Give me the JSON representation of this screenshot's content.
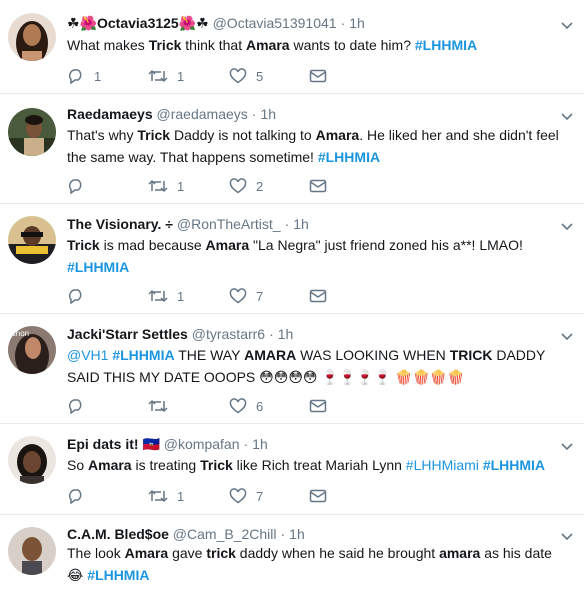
{
  "tweets": [
    {
      "name_prefix": "☘🌺",
      "name": "Octavia3125",
      "name_suffix": "🌺☘",
      "handle": "@Octavia51391041",
      "time": "1h",
      "text": [
        {
          "t": "What makes "
        },
        {
          "t": "Trick",
          "s": "b"
        },
        {
          "t": " think that "
        },
        {
          "t": "Amara",
          "s": "b"
        },
        {
          "t": " wants to date him? "
        },
        {
          "t": "#LHHMIA",
          "s": "tag"
        }
      ],
      "replies": "1",
      "retweets": "1",
      "likes": "5"
    },
    {
      "name": "Raedamaeys",
      "handle": "@raedamaeys",
      "time": "1h",
      "text": [
        {
          "t": "That's why "
        },
        {
          "t": "Trick",
          "s": "b"
        },
        {
          "t": " Daddy is not talking to "
        },
        {
          "t": "Amara",
          "s": "b"
        },
        {
          "t": ". He liked her and she didn't feel the same way. That happens sometime! "
        },
        {
          "t": "#LHHMIA",
          "s": "tag"
        }
      ],
      "replies": "",
      "retweets": "1",
      "likes": "2"
    },
    {
      "name": "The Visionary. ÷",
      "handle": "@RonTheArtist_",
      "time": "1h",
      "text": [
        {
          "t": "Trick",
          "s": "b"
        },
        {
          "t": " is mad because "
        },
        {
          "t": "Amara",
          "s": "b"
        },
        {
          "t": " \"La Negra\" just friend zoned his a**! LMAO! "
        },
        {
          "t": "#LHHMIA",
          "s": "tag"
        }
      ],
      "replies": "",
      "retweets": "1",
      "likes": "7"
    },
    {
      "name": "Jacki'Starr Settles",
      "handle": "@tyrastarr6",
      "time": "1h",
      "text": [
        {
          "t": "@VH1",
          "s": "tagl"
        },
        {
          "t": " "
        },
        {
          "t": "#LHHMIA",
          "s": "tag"
        },
        {
          "t": " THE WAY "
        },
        {
          "t": "AMARA",
          "s": "b"
        },
        {
          "t": " WAS LOOKING WHEN "
        },
        {
          "t": "TRICK",
          "s": "b"
        },
        {
          "t": " DADDY SAID THIS MY DATE OOOPS 😳😳😳😳 🍷🍷🍷🍷 🍿🍿🍿🍿"
        }
      ],
      "replies": "",
      "retweets": "",
      "likes": "6"
    },
    {
      "name": "Epi dats it!",
      "name_suffix": " 🇭🇹",
      "handle": "@kompafan",
      "time": "1h",
      "text": [
        {
          "t": "So "
        },
        {
          "t": "Amara",
          "s": "b"
        },
        {
          "t": " is treating "
        },
        {
          "t": "Trick",
          "s": "b"
        },
        {
          "t": " like Rich treat Mariah Lynn "
        },
        {
          "t": "#LHHMiami",
          "s": "tagl"
        },
        {
          "t": " "
        },
        {
          "t": "#LHHMIA",
          "s": "tag"
        }
      ],
      "replies": "",
      "retweets": "1",
      "likes": "7"
    },
    {
      "name": "C.A.M. Bled$oe",
      "handle": "@Cam_B_2Chill",
      "time": "1h",
      "text": [
        {
          "t": "The look "
        },
        {
          "t": "Amara",
          "s": "b"
        },
        {
          "t": " gave "
        },
        {
          "t": "trick",
          "s": "b"
        },
        {
          "t": " daddy when he said he brought "
        },
        {
          "t": "amara",
          "s": "b"
        },
        {
          "t": " as his date 😂 "
        },
        {
          "t": "#LHHMIA",
          "s": "tag"
        }
      ],
      "replies": "",
      "retweets": "",
      "likes": ""
    }
  ],
  "icons": {
    "reply": "reply-icon",
    "retweet": "retweet-icon",
    "like": "heart-icon",
    "dm": "envelope-icon",
    "more": "chevron-down-icon"
  },
  "colors": {
    "text": "#14171a",
    "muted": "#657786",
    "hashtag": "#1b95e0",
    "divider": "#e6ecf0"
  },
  "avatars": [
    "#3a2418",
    "#2c3b2a",
    "#c58a2a",
    "#5a4a42",
    "#2b2520",
    "#8a6a55"
  ]
}
